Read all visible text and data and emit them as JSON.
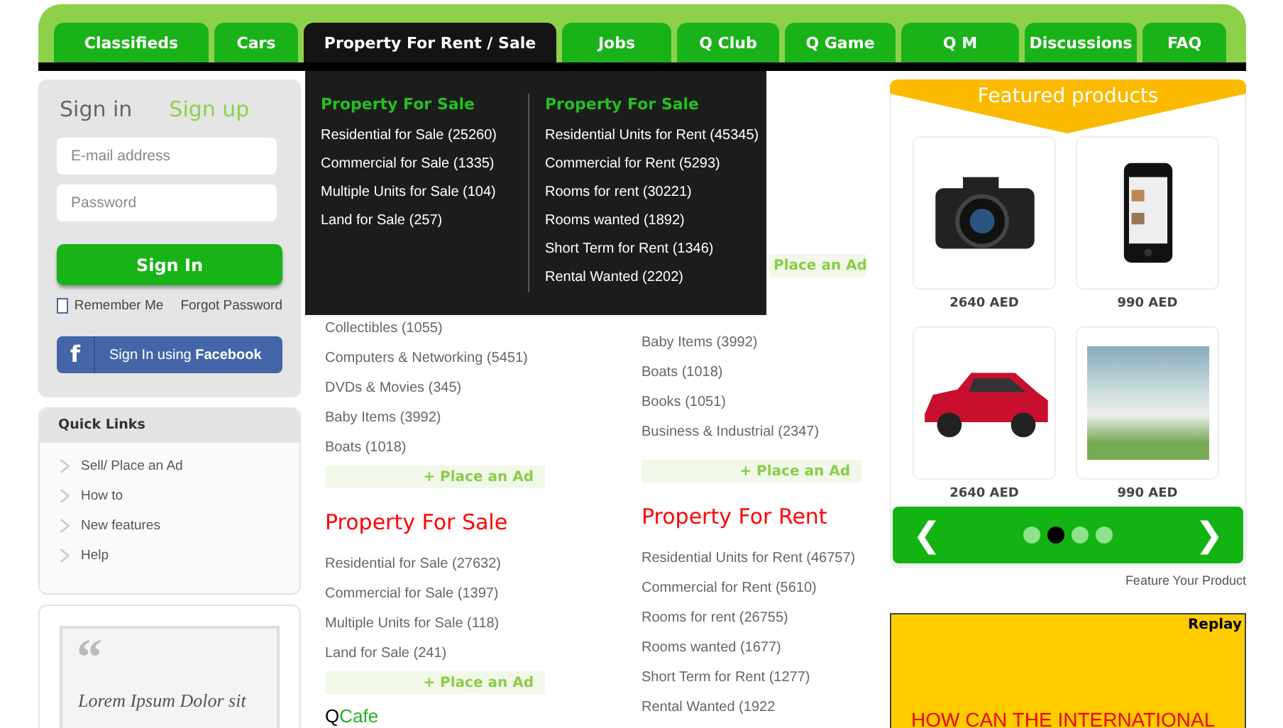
{
  "nav": {
    "tabs": [
      {
        "label": "Classifieds",
        "selected": false
      },
      {
        "label": "Cars",
        "selected": false
      },
      {
        "label": "Property For Rent / Sale",
        "selected": true
      },
      {
        "label": "Jobs",
        "selected": false
      },
      {
        "label": "Q Club",
        "selected": false
      },
      {
        "label": "Q Game",
        "selected": false
      },
      {
        "label": "Q M",
        "selected": false
      },
      {
        "label": "Discussions",
        "selected": false
      },
      {
        "label": "FAQ",
        "selected": false
      }
    ],
    "dropdown": {
      "columns": [
        {
          "heading": "Property For Sale",
          "items": [
            "Residential for Sale (25260)",
            "Commercial for Sale (1335)",
            "Multiple Units for Sale (104)",
            "Land for Sale (257)"
          ]
        },
        {
          "heading": "Property For Sale",
          "items": [
            "Residential Units for Rent (45345)",
            "Commercial for Rent (5293)",
            "Rooms for rent (30221)",
            "Rooms wanted (1892)",
            "Short Term for Rent (1346)",
            "Rental Wanted (2202)"
          ]
        }
      ]
    }
  },
  "signin": {
    "tabs": [
      {
        "label": "Sign in",
        "selected": true
      },
      {
        "label": "Sign up",
        "selected": false
      }
    ],
    "email": {
      "placeholder": "E-mail address"
    },
    "password": {
      "placeholder": "Password"
    },
    "button": "Sign In",
    "remember": {
      "label": "Remember Me",
      "checked": false
    },
    "forgot": "Forgot Password",
    "facebook": {
      "icon": "f",
      "label": "Sign In using **Facebook**"
    }
  },
  "quick_links": {
    "title": "Quick Links",
    "items": [
      "Sell/ Place an Ad",
      "How to",
      "New features",
      "Help"
    ]
  },
  "quote": {
    "mark": "“",
    "text": "Lorem Ipsum Dolor sit"
  },
  "listings": {
    "left": [
      {
        "kind": "items",
        "items": [
          "Collectibles (1055)",
          "Computers & Networking (5451)",
          "DVDs & Movies (345)",
          "Baby Items (3992)",
          "Boats (1018)"
        ]
      },
      {
        "kind": "place_ad",
        "label": "+ Place an Ad"
      },
      {
        "kind": "heading",
        "text": "Property For Sale"
      },
      {
        "kind": "items",
        "items": [
          "Residential for Sale (27632)",
          "Commercial for Sale (1397)",
          "Multiple Units for Sale (118)",
          "Land for Sale (241)"
        ]
      },
      {
        "kind": "place_ad",
        "label": "+ Place an Ad"
      },
      {
        "kind": "brand",
        "first": "Q",
        "rest": "Cafe"
      }
    ],
    "right": [
      {
        "kind": "place_ad",
        "label": "Place an Ad"
      },
      {
        "kind": "items",
        "items": [
          "Baby Items (3992)",
          "Boats (1018)",
          "Books (1051)",
          "Business & Industrial (2347)"
        ]
      },
      {
        "kind": "place_ad",
        "label": "+ Place an Ad"
      },
      {
        "kind": "heading",
        "text": "Property For Rent"
      },
      {
        "kind": "items",
        "items": [
          "Residential Units for Rent (46757)",
          "Commercial for Rent (5610)",
          "Rooms for rent (26755)",
          "Rooms wanted (1677)",
          "Short Term for Rent (1277)",
          "Rental Wanted (1922"
        ]
      }
    ]
  },
  "featured": {
    "title": "Featured products",
    "products": [
      {
        "kind": "camera",
        "price": "2640 AED"
      },
      {
        "kind": "phone",
        "price": "990 AED"
      },
      {
        "kind": "car",
        "price": "2640 AED"
      },
      {
        "kind": "house",
        "price": "990 AED"
      }
    ],
    "prev": "❮",
    "next": "❯",
    "dots": [
      {
        "selected": false
      },
      {
        "selected": true
      },
      {
        "selected": false
      },
      {
        "selected": false
      }
    ],
    "caption": "Feature Your Product"
  },
  "ad": {
    "replay": "Replay",
    "headline": "HOW CAN THE INTERNATIONAL"
  }
}
